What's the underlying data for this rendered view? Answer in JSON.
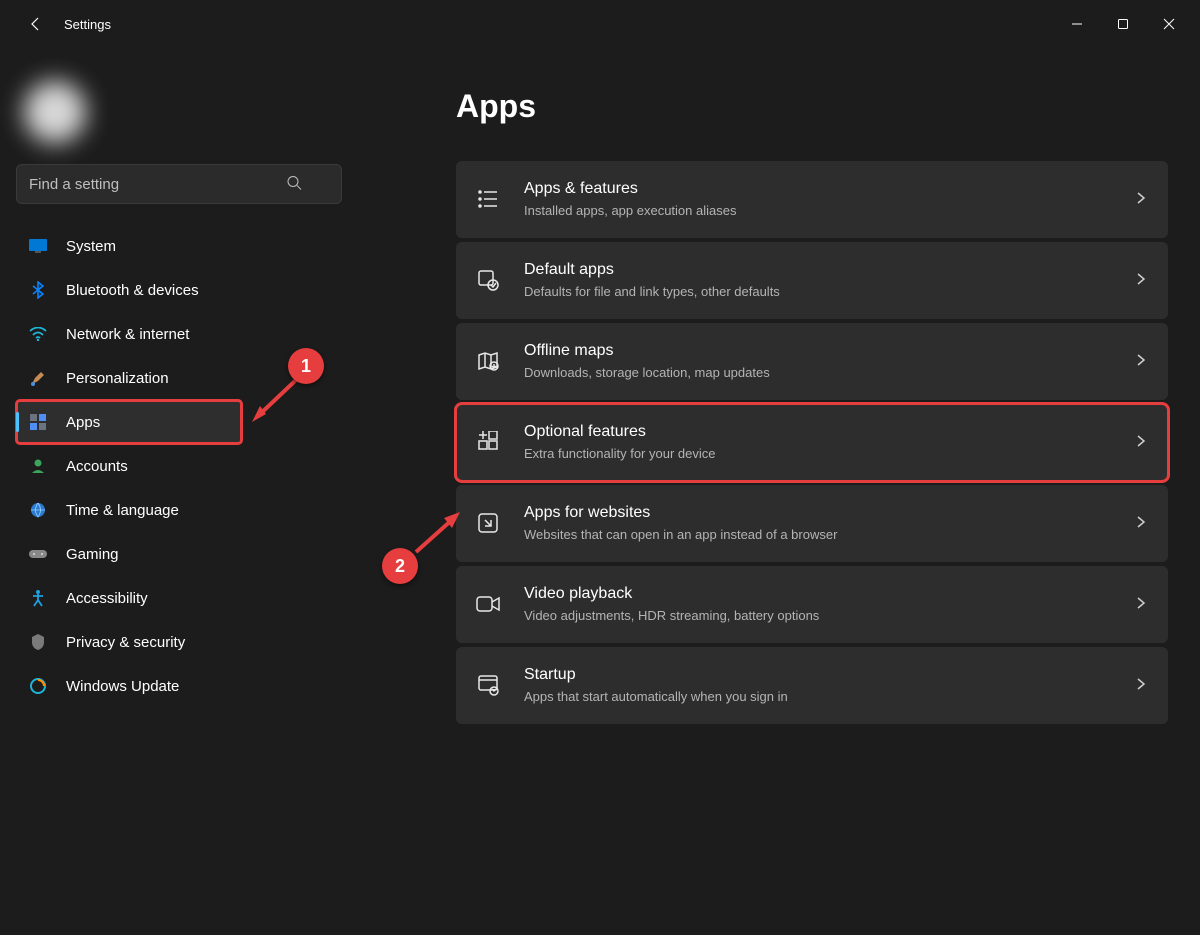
{
  "window": {
    "title": "Settings"
  },
  "profile": {
    "name": "",
    "email": ""
  },
  "search": {
    "placeholder": "Find a setting"
  },
  "sidebar": {
    "items": [
      {
        "label": "System",
        "icon": "display-icon"
      },
      {
        "label": "Bluetooth & devices",
        "icon": "bluetooth-icon"
      },
      {
        "label": "Network & internet",
        "icon": "wifi-icon"
      },
      {
        "label": "Personalization",
        "icon": "brush-icon"
      },
      {
        "label": "Apps",
        "icon": "apps-icon"
      },
      {
        "label": "Accounts",
        "icon": "person-icon"
      },
      {
        "label": "Time & language",
        "icon": "globe-clock-icon"
      },
      {
        "label": "Gaming",
        "icon": "gamepad-icon"
      },
      {
        "label": "Accessibility",
        "icon": "accessibility-icon"
      },
      {
        "label": "Privacy & security",
        "icon": "shield-icon"
      },
      {
        "label": "Windows Update",
        "icon": "update-icon"
      }
    ],
    "selected_index": 4
  },
  "page": {
    "heading": "Apps"
  },
  "cards": [
    {
      "title": "Apps & features",
      "desc": "Installed apps, app execution aliases",
      "icon": "list-icon"
    },
    {
      "title": "Default apps",
      "desc": "Defaults for file and link types, other defaults",
      "icon": "default-app-icon"
    },
    {
      "title": "Offline maps",
      "desc": "Downloads, storage location, map updates",
      "icon": "map-icon"
    },
    {
      "title": "Optional features",
      "desc": "Extra functionality for your device",
      "icon": "feature-plus-icon"
    },
    {
      "title": "Apps for websites",
      "desc": "Websites that can open in an app instead of a browser",
      "icon": "website-app-icon"
    },
    {
      "title": "Video playback",
      "desc": "Video adjustments, HDR streaming, battery options",
      "icon": "video-icon"
    },
    {
      "title": "Startup",
      "desc": "Apps that start automatically when you sign in",
      "icon": "startup-icon"
    }
  ],
  "annotations": {
    "callout1": "1",
    "callout2": "2"
  }
}
